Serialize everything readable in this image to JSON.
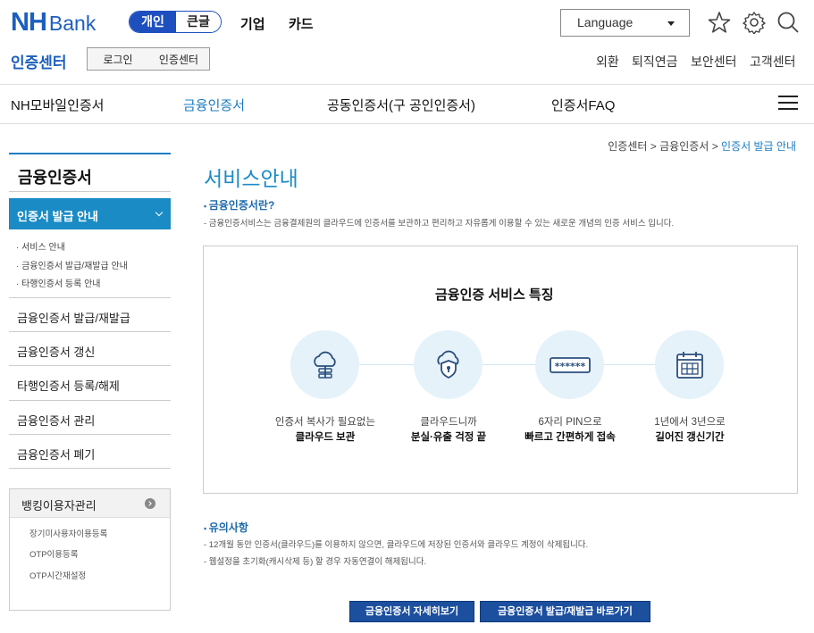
{
  "brand": {
    "nh": "NH",
    "bank": "Bank"
  },
  "segment": {
    "personal": "개인",
    "large": "큰글"
  },
  "top_nav": [
    "기업",
    "카드"
  ],
  "language": {
    "label": "Language"
  },
  "header_icons": [
    "star-icon",
    "gear-icon",
    "search-icon"
  ],
  "center_title": "인증센터",
  "crumb_buttons": [
    "로그인",
    "인증센터"
  ],
  "utility_links": [
    "외환",
    "퇴직연금",
    "보안센터",
    "고객센터"
  ],
  "main_nav": [
    "NH모바일인증서",
    "금융인증서",
    "공동인증서(구 공인인증서)",
    "인증서FAQ"
  ],
  "breadcrumb": {
    "a": "인증센터",
    "b": "금융인증서",
    "current": "인증서 발급 안내",
    "sep": ">"
  },
  "sidebar": {
    "title": "금융인증서",
    "active": "인증서 발급 안내",
    "subs": [
      "서비스 안내",
      "금융인증서 발급/재발급 안내",
      "타행인증서 등록 안내"
    ],
    "items": [
      "금융인증서 발급/재발급",
      "금융인증서 갱신",
      "타행인증서 등록/해제",
      "금융인증서 관리",
      "금융인증서 폐기"
    ],
    "box2_title": "뱅킹이용자관리",
    "box2_items": [
      "장기미사용자이용등록",
      "OTP이용등록",
      "OTP시간재설정"
    ]
  },
  "content": {
    "title": "서비스안내",
    "section1": "금융인증서란?",
    "section1_desc": "- 금융인증서비스는 금융결제원의 클라우드에 인증서를 보관하고 편리하고 자유롭게 이용할 수 있는 새로운 개념의 인증 서비스 입니다.",
    "features_title": "금융인증 서비스 특징",
    "features": [
      {
        "icon": "cloud-icon",
        "line1": "인증서 복사가 필요없는",
        "line2": "클라우드 보관"
      },
      {
        "icon": "shield-cloud-icon",
        "line1": "클라우드니까",
        "line2": "분실·유출 걱정 끝"
      },
      {
        "icon": "pin-icon",
        "line1": "6자리 PIN으로",
        "line2": "빠르고 간편하게 접속"
      },
      {
        "icon": "calendar-icon",
        "line1": "1년에서 3년으로",
        "line2": "길어진 갱신기간"
      }
    ],
    "pin_mask": "******",
    "section2": "유의사항",
    "notes": [
      "- 12개월 동안 인증서(클라우드)를 이용하지 않으면, 클라우드에 저장된 인증서와 클라우드 계정이 삭제됩니다.",
      "- 웹설정을 초기화(캐시삭제 등) 할 경우 자동연결이 해제됩니다."
    ],
    "buttons": [
      "금융인증서 자세히보기",
      "금융인증서 발급/재발급 바로가기"
    ]
  },
  "colors": {
    "brand_blue": "#1c5fbe",
    "accent": "#1a8bc4",
    "button": "#1c4f9e"
  }
}
